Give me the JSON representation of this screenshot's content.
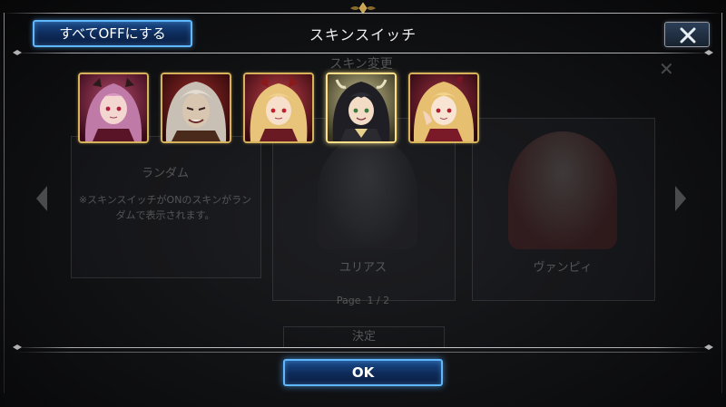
{
  "header": {
    "all_off_label": "すべてOFFにする",
    "title": "スキンスイッチ"
  },
  "background": {
    "title": "スキン変更",
    "random_label": "ランダム",
    "random_desc": "※スキンスイッチがONのスキンがランダムで表示されます。",
    "julius_label": "ユリアス",
    "vampy_label": "ヴァンピィ",
    "page_label": "Page",
    "page_value": "1 / 2",
    "decide_label": "決定"
  },
  "skins": [
    {
      "id": "skin-1",
      "icon": "character-portrait-pink-hair"
    },
    {
      "id": "skin-2",
      "icon": "character-portrait-silver-hair"
    },
    {
      "id": "skin-3",
      "icon": "character-portrait-blonde-hair"
    },
    {
      "id": "skin-4",
      "icon": "character-portrait-dark-hair"
    },
    {
      "id": "skin-5",
      "icon": "character-portrait-blonde-twintails"
    }
  ],
  "footer": {
    "ok_label": "OK"
  },
  "colors": {
    "button_border": "#5fb8ff",
    "button_fill": "#0d2a58",
    "icon_frame": "#d6b25a"
  }
}
